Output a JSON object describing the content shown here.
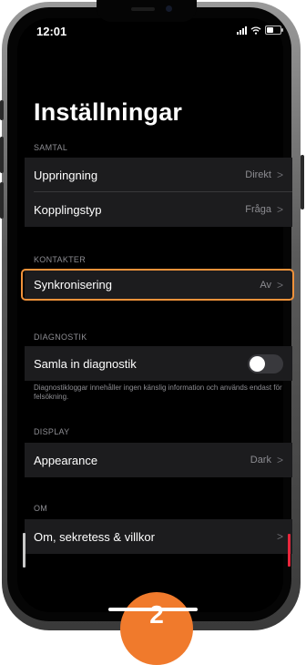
{
  "status_bar": {
    "time": "12:01",
    "battery_level": 0.5
  },
  "page": {
    "title": "Inställningar"
  },
  "sections": {
    "call": {
      "header": "SAMTAL",
      "rows": [
        {
          "label": "Uppringning",
          "value": "Direkt"
        },
        {
          "label": "Kopplingstyp",
          "value": "Fråga"
        }
      ]
    },
    "contacts": {
      "header": "KONTAKTER",
      "rows": [
        {
          "label": "Synkronisering",
          "value": "Av"
        }
      ]
    },
    "diagnostics": {
      "header": "DIAGNOSTIK",
      "rows": [
        {
          "label": "Samla in diagnostik",
          "toggle_on": false
        }
      ],
      "footer": "Diagnostikloggar innehåller ingen känslig information och används endast för felsökning."
    },
    "display": {
      "header": "DISPLAY",
      "rows": [
        {
          "label": "Appearance",
          "value": "Dark"
        }
      ]
    },
    "about": {
      "header": "OM",
      "rows": [
        {
          "label": "Om, sekretess & villkor"
        }
      ]
    }
  },
  "chevron": ">",
  "step_badge": "2",
  "colors": {
    "background": "#000000",
    "row_background": "#1c1c1e",
    "secondary_text": "#8d8d92",
    "highlight": "#f0923a",
    "badge": "#f07a2c",
    "scroll_accent": "#e8263c"
  }
}
